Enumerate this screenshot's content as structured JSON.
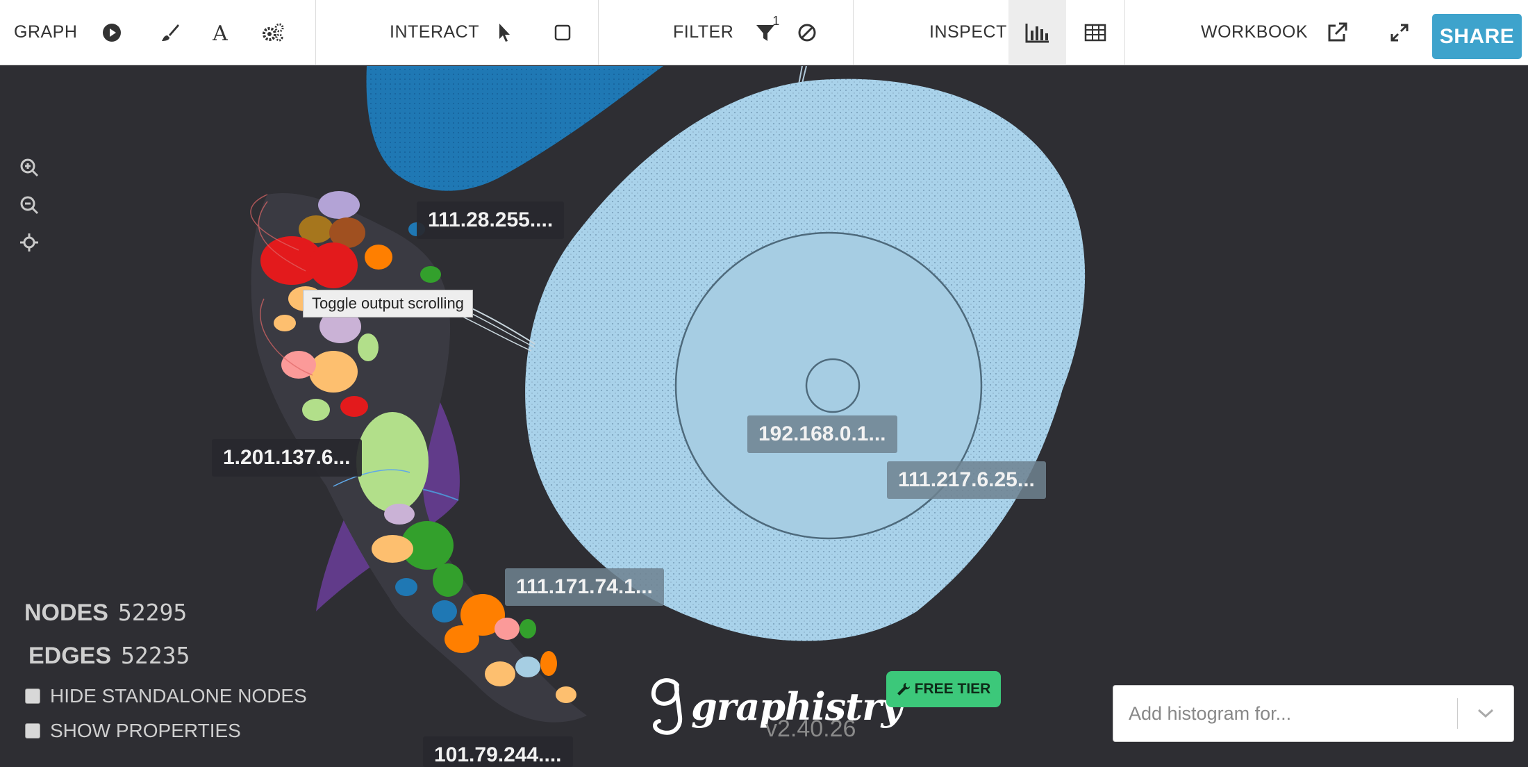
{
  "toolbar": {
    "graph_label": "GRAPH",
    "interact_label": "INTERACT",
    "filter_label": "FILTER",
    "filter_badge": "1",
    "inspect_label": "INSPECT",
    "workbook_label": "WORKBOOK",
    "share_label": "SHARE"
  },
  "icons": {
    "play": "play-icon",
    "brush": "brush-icon",
    "font": "font-icon",
    "settings": "gears-icon",
    "pointer": "pointer-icon",
    "select": "square-icon",
    "filter": "funnel-icon",
    "exclude": "ban-icon",
    "histogram": "bar-chart-icon",
    "table": "table-icon",
    "external": "external-link-icon",
    "expand": "expand-icon"
  },
  "graph_labels": {
    "l1": "111.28.255....",
    "l2": "1.201.137.6...",
    "l3": "192.168.0.1...",
    "l4": "111.217.6.25...",
    "l5": "111.171.74.1...",
    "l6": "101.79.244...."
  },
  "tooltip": "Toggle output scrolling",
  "stats": {
    "nodes_label": "NODES",
    "nodes_value": "52295",
    "edges_label": "EDGES",
    "edges_value": "52235"
  },
  "options": {
    "hide_standalone": "HIDE STANDALONE NODES",
    "show_properties": "SHOW PROPERTIES"
  },
  "brand": {
    "name": "graphistry",
    "version": "v2.40.26",
    "tier": "FREE TIER"
  },
  "histogram": {
    "placeholder": "Add histogram for..."
  },
  "colors": {
    "background": "#2e2e33",
    "accent": "#3ea3cc",
    "tier": "#3cc87a",
    "cluster_light_blue": "#a9d2ea",
    "cluster_blue": "#1f78b4"
  }
}
